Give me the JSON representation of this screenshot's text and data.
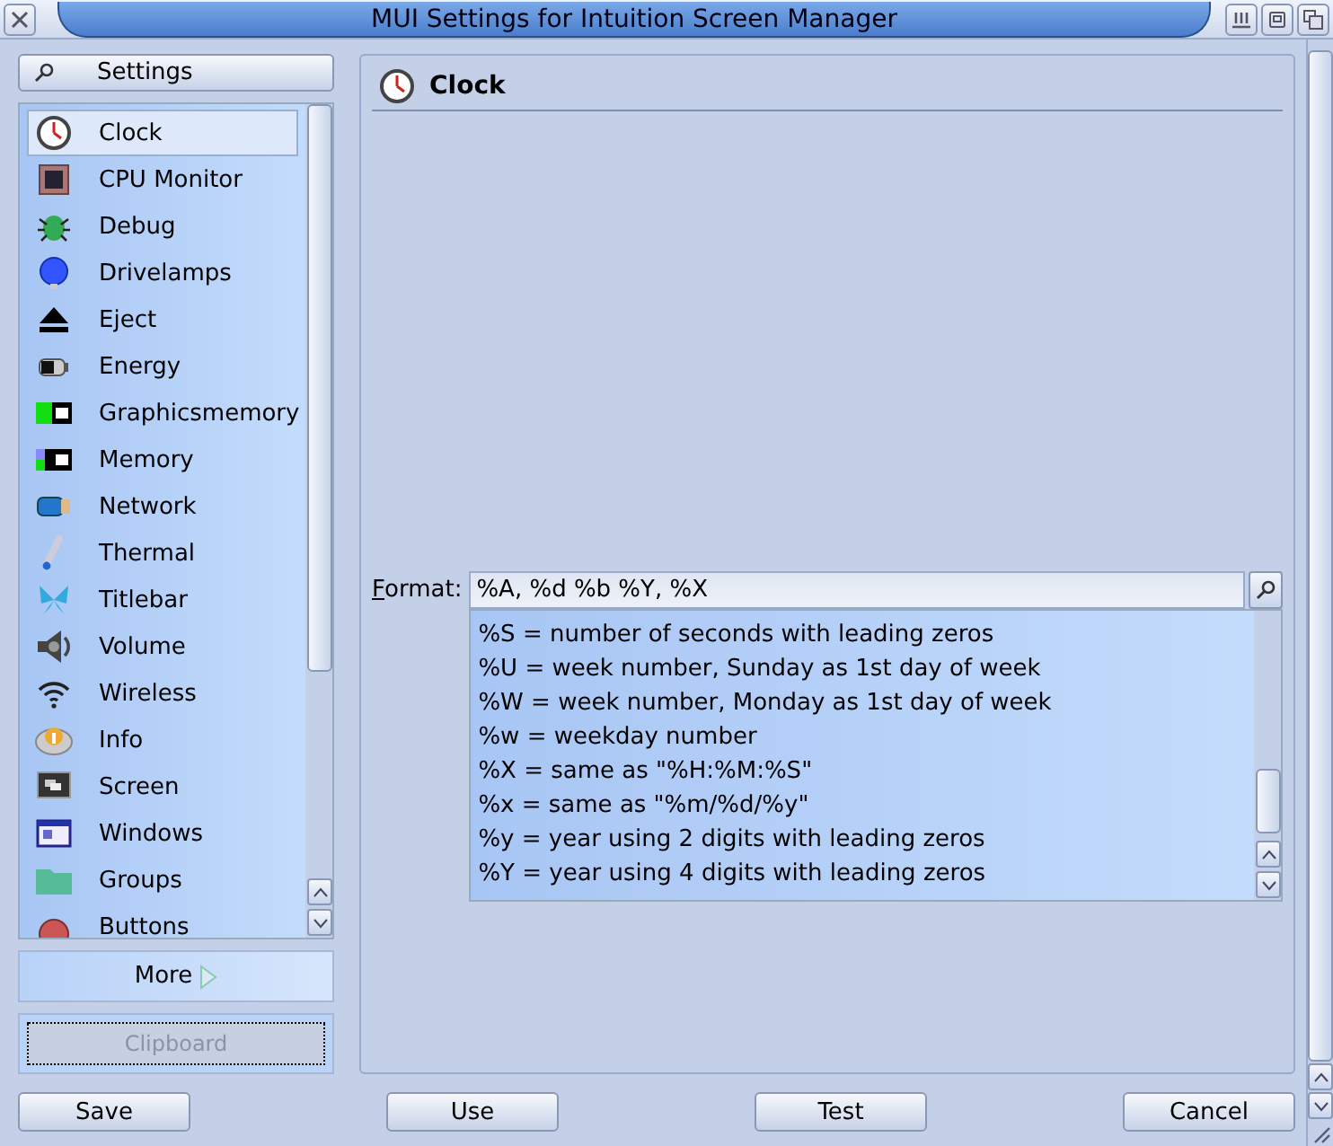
{
  "window": {
    "title": "MUI Settings for Intuition Screen Manager"
  },
  "sidebar": {
    "header_button": "Settings",
    "items": [
      {
        "label": "Clock",
        "selected": true
      },
      {
        "label": "CPU Monitor",
        "selected": false
      },
      {
        "label": "Debug",
        "selected": false
      },
      {
        "label": "Drivelamps",
        "selected": false
      },
      {
        "label": "Eject",
        "selected": false
      },
      {
        "label": "Energy",
        "selected": false
      },
      {
        "label": "Graphicsmemory",
        "selected": false
      },
      {
        "label": "Memory",
        "selected": false
      },
      {
        "label": "Network",
        "selected": false
      },
      {
        "label": "Thermal",
        "selected": false
      },
      {
        "label": "Titlebar",
        "selected": false
      },
      {
        "label": "Volume",
        "selected": false
      },
      {
        "label": "Wireless",
        "selected": false
      },
      {
        "label": "Info",
        "selected": false
      },
      {
        "label": "Screen",
        "selected": false
      },
      {
        "label": "Windows",
        "selected": false
      },
      {
        "label": "Groups",
        "selected": false
      },
      {
        "label": "Buttons",
        "selected": false
      }
    ],
    "more_button": "More",
    "clipboard_button": {
      "label": "Clipboard",
      "disabled": true
    }
  },
  "panel": {
    "title": "Clock",
    "format": {
      "label": "Format:",
      "value": "%A, %d %b %Y, %X",
      "options": [
        "%S = number of seconds with leading zeros",
        "%U = week number, Sunday as 1st day of week",
        "%W = week number, Monday as 1st day of week",
        "%w = weekday number",
        "%X = same as \"%H:%M:%S\"",
        "%x = same as \"%m/%d/%y\"",
        "%y = year using 2 digits with leading zeros",
        "%Y = year using 4 digits with leading zeros"
      ]
    }
  },
  "buttons": [
    "Save",
    "Use",
    "Test",
    "Cancel"
  ]
}
